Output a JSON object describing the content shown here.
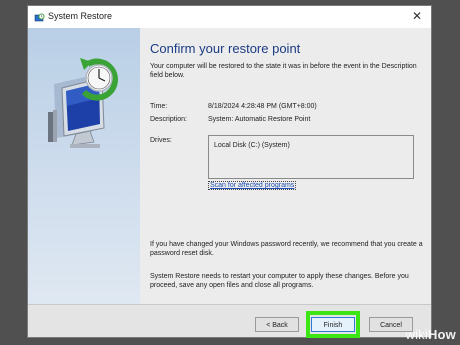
{
  "window": {
    "title": "System Restore",
    "title_icon": "system-restore-icon",
    "close_icon": "close-icon"
  },
  "main": {
    "heading": "Confirm your restore point",
    "intro": "Your computer will be restored to the state it was in before the event in the Description field below.",
    "time_label": "Time:",
    "time_value": "8/18/2024 4:28:48 PM (GMT+8:00)",
    "description_label": "Description:",
    "description_value": "System: Automatic Restore Point",
    "drives_label": "Drives:",
    "drives": [
      "Local Disk (C:) (System)"
    ],
    "scan_link": "Scan for affected programs",
    "password_note": "If you have changed your Windows password recently, we recommend that you create a password reset disk.",
    "restart_note": "System Restore needs to restart your computer to apply these changes. Before you proceed, save any open files and close all programs."
  },
  "buttons": {
    "back": "< Back",
    "finish": "Finish",
    "cancel": "Cancel"
  },
  "colors": {
    "heading": "#1b3b84",
    "link": "#1f4fb4",
    "highlight": "#3ce614"
  },
  "watermark": {
    "wiki": "wiki",
    "how": "How"
  }
}
